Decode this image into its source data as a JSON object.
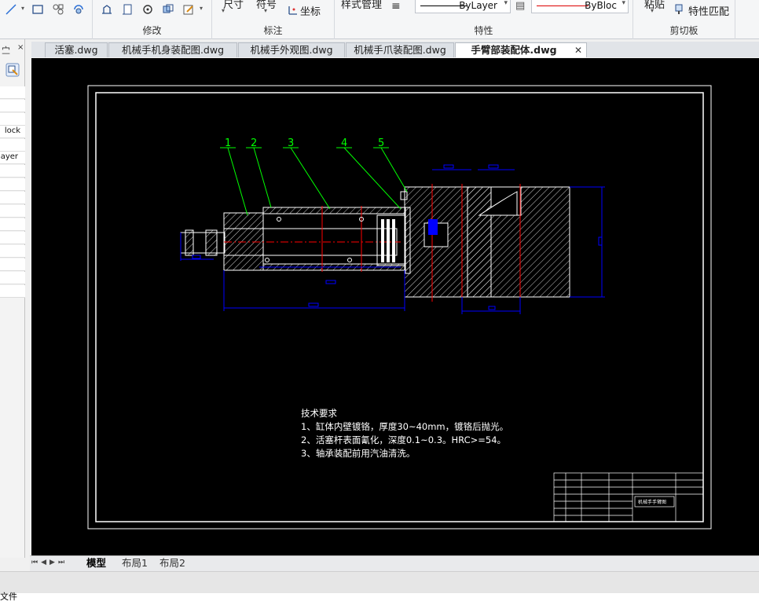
{
  "ribbon": {
    "groups": [
      {
        "title": "修改",
        "buttons": []
      },
      {
        "title": "标注",
        "buttons": [
          "尺寸",
          "符号",
          "坐标"
        ]
      },
      {
        "title": "特性",
        "buttons": [
          "样式管理"
        ],
        "linetype": "ByLayer",
        "color": "ByBloc"
      },
      {
        "title": "剪切板",
        "buttons": [
          "粘贴",
          "特性匹配"
        ]
      }
    ]
  },
  "left_panel": {
    "header": "㝉",
    "rows": [
      "lock",
      "ayer"
    ]
  },
  "file_tabs": [
    {
      "label": "活塞.dwg"
    },
    {
      "label": "机械手机身装配图.dwg"
    },
    {
      "label": "机械手外观图.dwg"
    },
    {
      "label": "机械手爪装配图.dwg"
    },
    {
      "label": "手臂部装配体.dwg",
      "active": true
    }
  ],
  "drawing": {
    "balloons": [
      "1",
      "2",
      "3",
      "4",
      "5"
    ],
    "notes_title": "技术要求",
    "notes": [
      "1、缸体内壁镀铬，厚度30~40mm，镀铬后抛光。",
      "2、活塞杆表面氰化，深度0.1~0.3。HRC>=54。",
      "3、轴承装配前用汽油清洗。"
    ],
    "title_block_name": "机械手手臂图"
  },
  "layout_tabs": [
    {
      "label": "模型",
      "active": true
    },
    {
      "label": "布局1"
    },
    {
      "label": "布局2"
    }
  ],
  "status": {
    "text": "文件"
  },
  "colors": {
    "canvas": "#000000",
    "leader": "#00ff00",
    "dimension": "#0000ff",
    "center": "#ff0000",
    "geometry": "#ffffff"
  }
}
